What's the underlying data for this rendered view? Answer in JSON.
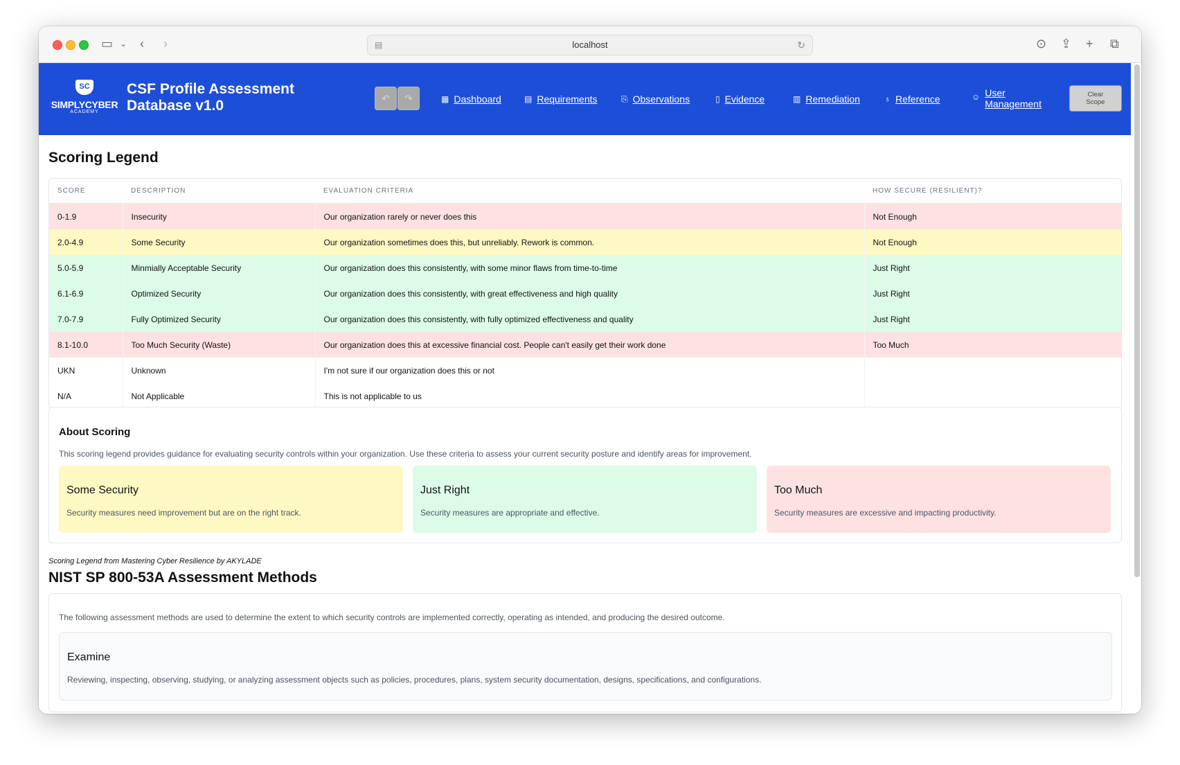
{
  "browser": {
    "url": "localhost"
  },
  "header": {
    "logo": {
      "badge": "SC",
      "brand": "SIMPLYCYBER",
      "sub": "ACADEMY"
    },
    "title": "CSF Profile Assessment Database v1.0",
    "nav": [
      {
        "label": "Dashboard",
        "icon": "grid-icon"
      },
      {
        "label": "Requirements",
        "icon": "document-icon"
      },
      {
        "label": "Observations",
        "icon": "search-doc-icon"
      },
      {
        "label": "Evidence",
        "icon": "file-search-icon"
      },
      {
        "label": "Remediation",
        "icon": "clipboard-icon"
      },
      {
        "label": "Reference",
        "icon": "ribbon-icon"
      },
      {
        "label": "User Management",
        "icon": "users-icon"
      }
    ],
    "clear_scope": "Clear Scope"
  },
  "legend": {
    "title": "Scoring Legend",
    "columns": [
      "SCORE",
      "DESCRIPTION",
      "EVALUATION CRITERIA",
      "HOW SECURE (RESILIENT)?"
    ],
    "rows": [
      {
        "score": "0-1.9",
        "description": "Insecurity",
        "criteria": "Our organization rarely or never does this",
        "secure": "Not Enough",
        "color": "red"
      },
      {
        "score": "2.0-4.9",
        "description": "Some Security",
        "criteria": "Our organization sometimes does this, but unreliably. Rework is common.",
        "secure": "Not Enough",
        "color": "yellow"
      },
      {
        "score": "5.0-5.9",
        "description": "Minmially Acceptable Security",
        "criteria": "Our organization does this consistently, with some minor flaws from time-to-time",
        "secure": "Just Right",
        "color": "green"
      },
      {
        "score": "6.1-6.9",
        "description": "Optimized Security",
        "criteria": "Our organization does this consistently, with great effectiveness and high quality",
        "secure": "Just Right",
        "color": "green"
      },
      {
        "score": "7.0-7.9",
        "description": "Fully Optimized Security",
        "criteria": "Our organization does this consistently, with fully optimized effectiveness and quality",
        "secure": "Just Right",
        "color": "green"
      },
      {
        "score": "8.1-10.0",
        "description": "Too Much Security (Waste)",
        "criteria": "Our organization does this at excessive financial cost. People can't easily get their work done",
        "secure": "Too Much",
        "color": "red"
      },
      {
        "score": "UKN",
        "description": "Unknown",
        "criteria": "I'm not sure if our organization does this or not",
        "secure": "",
        "color": "none"
      },
      {
        "score": "N/A",
        "description": "Not Applicable",
        "criteria": "This is not applicable to us",
        "secure": "",
        "color": "none"
      }
    ]
  },
  "about": {
    "title": "About Scoring",
    "description": "This scoring legend provides guidance for evaluating security controls within your organization. Use these criteria to assess your current security posture and identify areas for improvement.",
    "cards": [
      {
        "title": "Some Security",
        "text": "Security measures need improvement but are on the right track."
      },
      {
        "title": "Just Right",
        "text": "Security measures are appropriate and effective."
      },
      {
        "title": "Too Much",
        "text": "Security measures are excessive and impacting productivity."
      }
    ]
  },
  "credit": "Scoring Legend from Mastering Cyber Resilience by AKYLADE",
  "nist": {
    "title": "NIST SP 800-53A Assessment Methods",
    "intro": "The following assessment methods are used to determine the extent to which security controls are implemented correctly, operating as intended, and producing the desired outcome.",
    "methods": [
      {
        "title": "Examine",
        "text": "Reviewing, inspecting, observing, studying, or analyzing assessment objects such as policies, procedures, plans, system security documentation, designs, specifications, and configurations."
      }
    ]
  },
  "colors": {
    "header_bg": "#1d4ed8",
    "row_red": "#fee2e2",
    "row_yellow": "#fef9c3",
    "row_green": "#dcfce7"
  }
}
